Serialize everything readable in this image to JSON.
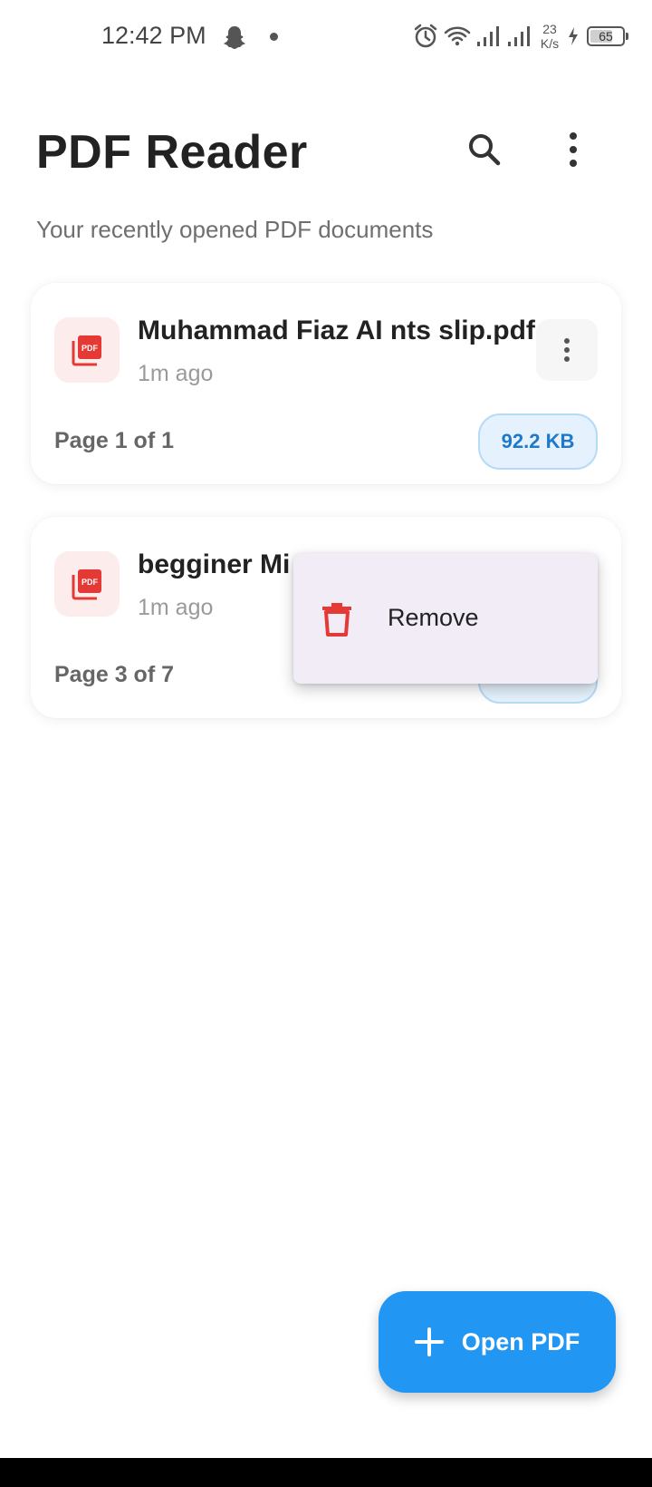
{
  "status_bar": {
    "time": "12:42 PM",
    "net_speed_value": "23",
    "net_speed_unit": "K/s",
    "battery_level": "65"
  },
  "header": {
    "title": "PDF Reader",
    "subtitle": "Your recently opened PDF documents"
  },
  "documents": [
    {
      "title": "Muhammad Fiaz AI nts slip.pdf",
      "time": "1m ago",
      "pages": "Page 1 of 1",
      "size": "92.2 KB"
    },
    {
      "title": "begginer Mi",
      "time": "1m ago",
      "pages": "Page 3 of 7",
      "size": ""
    }
  ],
  "popup_menu": {
    "remove_label": "Remove"
  },
  "fab": {
    "label": "Open PDF"
  },
  "colors": {
    "primary": "#2196f3",
    "pdf_red": "#e53935",
    "badge_bg": "#e5f2fd",
    "badge_text": "#1f78c8",
    "menu_bg": "#f2ecf6"
  }
}
